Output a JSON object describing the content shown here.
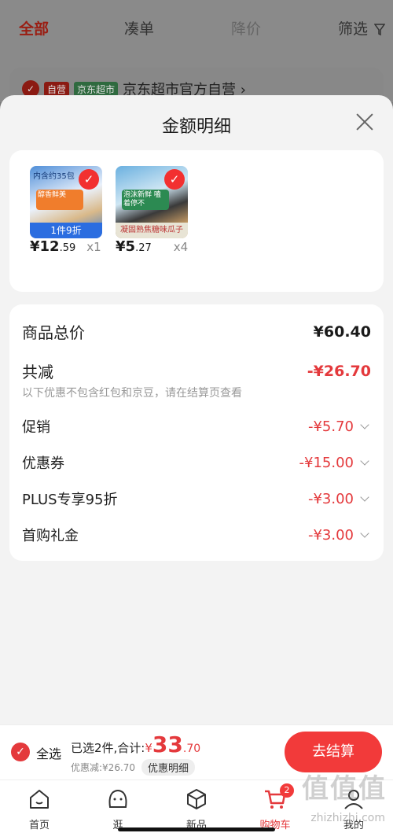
{
  "background": {
    "tabs": [
      {
        "label": "全部",
        "state": "active"
      },
      {
        "label": "凑单",
        "state": "normal"
      },
      {
        "label": "降价",
        "state": "muted"
      },
      {
        "label": "筛选",
        "state": "normal"
      }
    ],
    "store": {
      "badge_self": "自营",
      "badge_market": "京东超市",
      "name": "京东超市官方自营 ›"
    }
  },
  "sheet": {
    "title": "金额明细",
    "products": [
      {
        "image_label": "内含约35包",
        "mid_text": "醇香鲜美",
        "tag": "1件9折",
        "price_main": "¥12",
        "price_cents": ".59",
        "qty": "x1"
      },
      {
        "image_label": "",
        "mid_text": "泡沫新鲜 嗑着停不",
        "tag": "凝固熟焦糖味瓜子",
        "price_main": "¥5",
        "price_cents": ".27",
        "qty": "x4"
      }
    ],
    "detail": {
      "total_label": "商品总价",
      "total_value": "¥60.40",
      "reduce_label": "共减",
      "reduce_value": "-¥26.70",
      "note": "以下优惠不包含红包和京豆，请在结算页查看",
      "items": [
        {
          "label": "促销",
          "value": "-¥5.70"
        },
        {
          "label": "优惠券",
          "value": "-¥15.00"
        },
        {
          "label": "PLUS专享95折",
          "value": "-¥3.00"
        },
        {
          "label": "首购礼金",
          "value": "-¥3.00"
        }
      ]
    }
  },
  "bottom_bar": {
    "select_all": "全选",
    "selected_text": "已选2件,合计:",
    "currency": "¥",
    "amount": "33",
    "cents": ".70",
    "discount_text": "优惠减:¥26.70",
    "detail_pill": "优惠明细",
    "checkout": "去结算"
  },
  "tabbar": {
    "items": [
      {
        "label": "首页",
        "icon": "home-icon"
      },
      {
        "label": "逛",
        "icon": "explore-icon"
      },
      {
        "label": "新品",
        "icon": "new-product-icon"
      },
      {
        "label": "购物车",
        "icon": "cart-icon",
        "badge": "2"
      },
      {
        "label": "我的",
        "icon": "profile-icon"
      }
    ]
  },
  "watermark": {
    "main": "值值值",
    "sub": "zhizhizhi.com"
  },
  "colors": {
    "accent": "#e4393c",
    "checkout": "#f23a3a",
    "overlay": "#7a7a7a"
  }
}
